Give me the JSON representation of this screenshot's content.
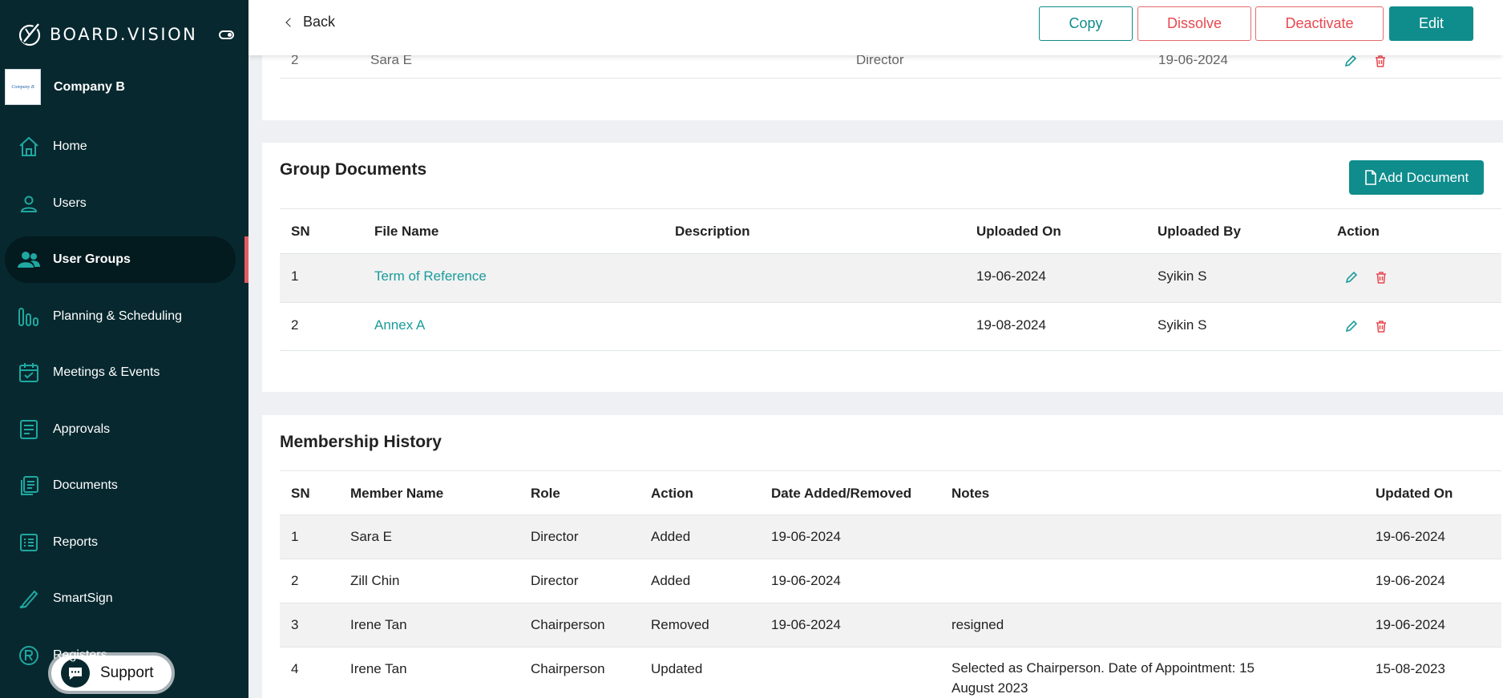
{
  "brand": {
    "name": "BOARD.VISION"
  },
  "company": {
    "logo_text": "Company B",
    "name": "Company B"
  },
  "nav": [
    {
      "label": "Home",
      "icon": "home-icon"
    },
    {
      "label": "Users",
      "icon": "user-icon"
    },
    {
      "label": "User Groups",
      "icon": "user-group-icon",
      "active": true
    },
    {
      "label": "Planning & Scheduling",
      "icon": "bar-chart-icon"
    },
    {
      "label": "Meetings & Events",
      "icon": "calendar-icon"
    },
    {
      "label": "Approvals",
      "icon": "approval-icon"
    },
    {
      "label": "Documents",
      "icon": "documents-icon"
    },
    {
      "label": "Reports",
      "icon": "reports-icon"
    },
    {
      "label": "SmartSign",
      "icon": "pen-icon"
    },
    {
      "label": "Registers",
      "icon": "registered-icon"
    }
  ],
  "support": {
    "label": "Support"
  },
  "topbar": {
    "back": "Back",
    "copy": "Copy",
    "dissolve": "Dissolve",
    "deactivate": "Deactivate",
    "edit": "Edit"
  },
  "members_partial": {
    "sn": "2",
    "name": "Sara E",
    "role": "Director",
    "date": "19-06-2024"
  },
  "group_documents": {
    "title": "Group Documents",
    "add_button": "Add Document",
    "headers": [
      "SN",
      "File Name",
      "Description",
      "Uploaded On",
      "Uploaded By",
      "Action"
    ],
    "rows": [
      {
        "sn": "1",
        "file_name": "Term of Reference",
        "description": "",
        "uploaded_on": "19-06-2024",
        "uploaded_by": "Syikin S"
      },
      {
        "sn": "2",
        "file_name": "Annex A",
        "description": "",
        "uploaded_on": "19-08-2024",
        "uploaded_by": "Syikin S"
      }
    ]
  },
  "membership_history": {
    "title": "Membership History",
    "headers": [
      "SN",
      "Member Name",
      "Role",
      "Action",
      "Date Added/Removed",
      "Notes",
      "Updated On"
    ],
    "rows": [
      {
        "sn": "1",
        "member": "Sara E",
        "role": "Director",
        "action": "Added",
        "date": "19-06-2024",
        "notes": "",
        "updated": "19-06-2024"
      },
      {
        "sn": "2",
        "member": "Zill Chin",
        "role": "Director",
        "action": "Added",
        "date": "19-06-2024",
        "notes": "",
        "updated": "19-06-2024"
      },
      {
        "sn": "3",
        "member": "Irene Tan",
        "role": "Chairperson",
        "action": "Removed",
        "date": "19-06-2024",
        "notes": "resigned",
        "updated": "19-06-2024"
      },
      {
        "sn": "4",
        "member": "Irene Tan",
        "role": "Chairperson",
        "action": "Updated",
        "date": "",
        "notes": "Selected as Chairperson. Date of Appointment: 15 August 2023",
        "updated": "15-08-2023"
      }
    ]
  },
  "colors": {
    "sidebar": "#07282f",
    "accent": "#0f8c8c",
    "danger": "#e8484f",
    "active_marker": "#e35b62"
  }
}
